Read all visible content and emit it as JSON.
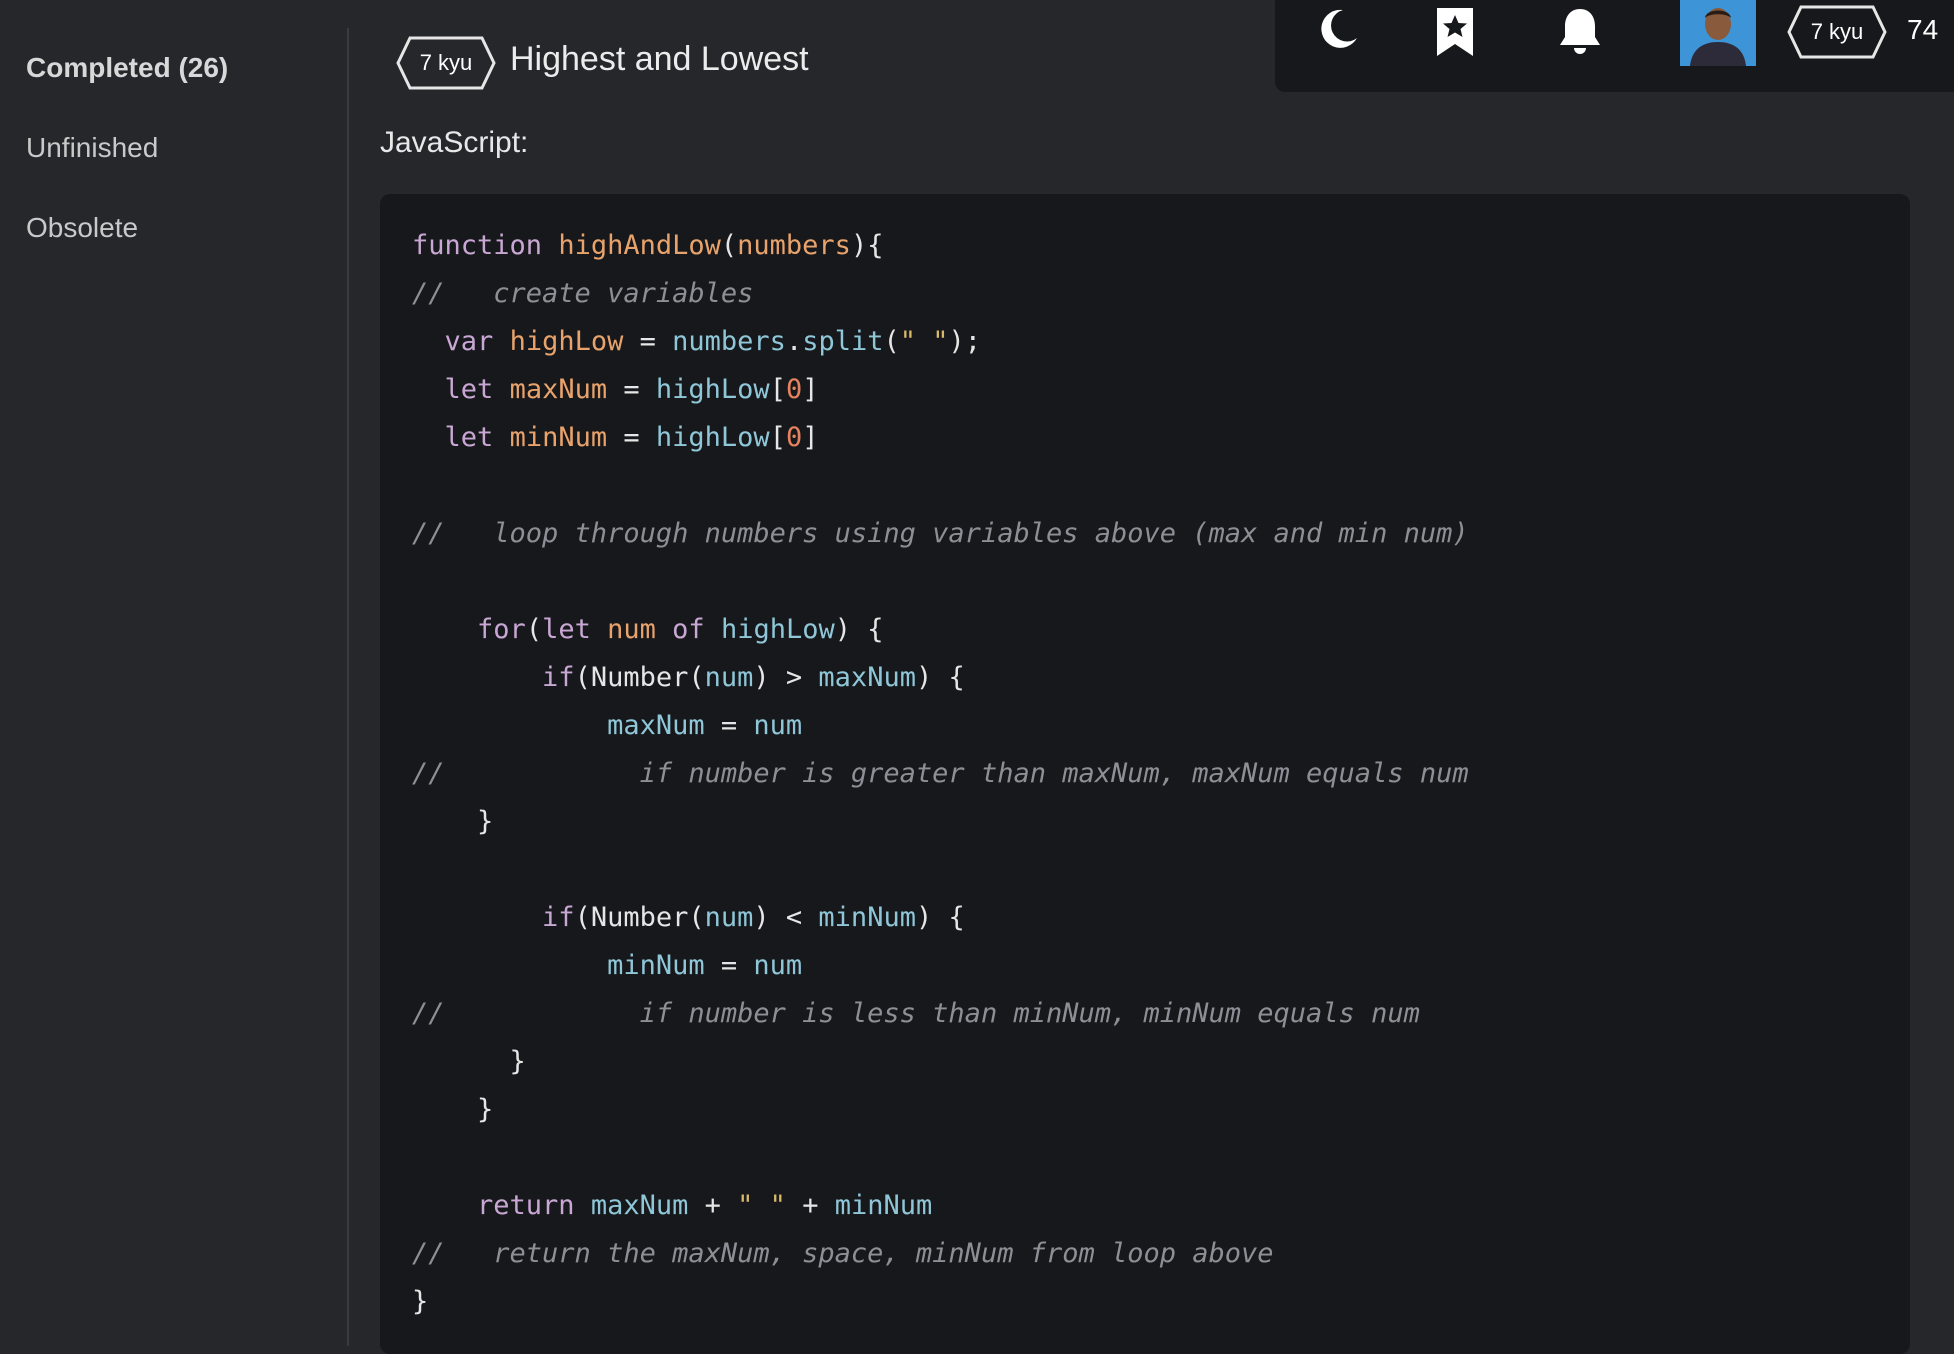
{
  "sidebar": {
    "items": [
      {
        "label": "Completed (26)",
        "active": true
      },
      {
        "label": "Unfinished",
        "active": false
      },
      {
        "label": "Obsolete",
        "active": false
      }
    ]
  },
  "topbar": {
    "icons": [
      "moon-icon",
      "bookmark-star-icon",
      "bell-icon"
    ],
    "rank": "7 kyu",
    "honor": "74"
  },
  "kata": {
    "rank": "7 kyu",
    "title": "Highest and Lowest",
    "language_label": "JavaScript:"
  },
  "code_lines": [
    "function highAndLow(numbers){",
    "//   create variables",
    "  var highLow = numbers.split(\" \");",
    "  let maxNum = highLow[0]",
    "  let minNum = highLow[0]",
    "",
    "//   loop through numbers using variables above (max and min num)",
    "",
    "    for(let num of highLow) {",
    "        if(Number(num) > maxNum) {",
    "            maxNum = num",
    "//            if number is greater than maxNum, maxNum equals num",
    "    }",
    "",
    "        if(Number(num) < minNum) {",
    "            minNum = num",
    "//            if number is less than minNum, minNum equals num",
    "      }",
    "    }",
    "",
    "    return maxNum + \" \" + minNum",
    "//   return the maxNum, space, minNum from loop above",
    "}"
  ],
  "colors": {
    "keyword": "#c9a7d4",
    "function_name": "#e8a36c",
    "variable": "#8fc7d8",
    "number": "#e5825f",
    "string": "#d8b96a",
    "comment": "#8d8f96",
    "background": "#26272b",
    "code_background": "#17181b"
  }
}
